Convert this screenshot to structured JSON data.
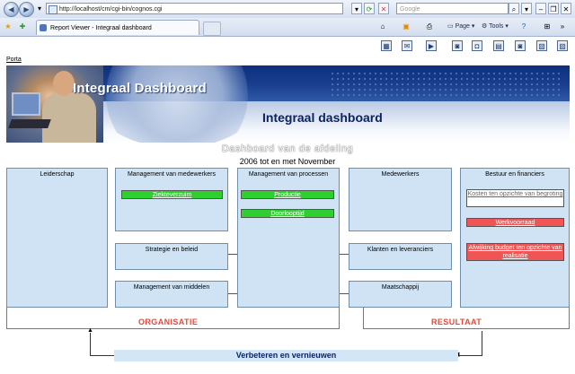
{
  "browser": {
    "address": "http://localhost/cm/cgi-bin/cognos.cgi",
    "search_placeholder": "Google",
    "tab_title": "Report Viewer - Integraal dashboard",
    "page_label": "Page",
    "tools_label": "Tools"
  },
  "report": {
    "portal_link": "Porta",
    "banner_title": "Integraal Dashboard",
    "main_title": "Integraal dashboard",
    "subtitle": "Dashboard van de afdeling",
    "period": "2006 tot en met November"
  },
  "organisatie": {
    "label": "ORGANISATIE",
    "leiderschap": {
      "title": "Leiderschap"
    },
    "management_medewerkers": {
      "title": "Management van medewerkers",
      "items": [
        "Ziekteverzuim"
      ]
    },
    "strategie": {
      "title": "Strategie en beleid"
    },
    "management_middelen": {
      "title": "Management van middelen"
    },
    "management_processen": {
      "title": "Management van processen",
      "items": [
        "Productie",
        "Doorlooptijd"
      ]
    }
  },
  "resultaat": {
    "label": "RESULTAAT",
    "medewerkers": {
      "title": "Medewerkers"
    },
    "klanten": {
      "title": "Klanten en leveranciers"
    },
    "maatschappij": {
      "title": "Maatschappij"
    },
    "bestuur": {
      "title": "Bestuur en financiers",
      "items": [
        "Kosten ten opzichte van begroting",
        "Werkvoorraad",
        "Afwijking budget ten opzichte van realisatie"
      ]
    }
  },
  "improve_label": "Verbeteren en vernieuwen",
  "colors": {
    "box": "#cfe3f4",
    "good": "#2fcf2f",
    "bad": "#ef5555",
    "title": "#0b2363",
    "footer": "#e24a3a"
  }
}
